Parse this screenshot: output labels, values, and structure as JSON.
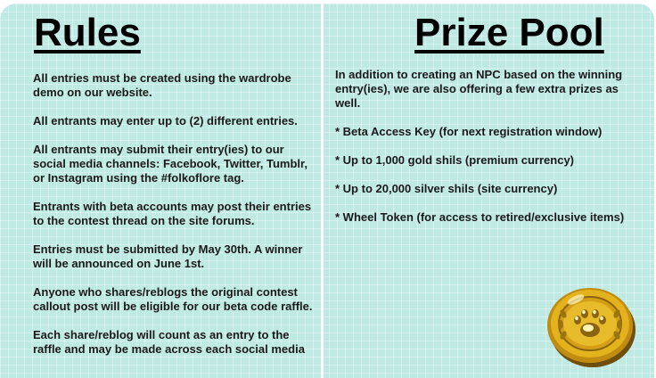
{
  "rules": {
    "title": "Rules",
    "paragraphs": [
      "All entries must be created using the wardrobe demo on our website.",
      "All entrants may enter up to (2) different entries.",
      "All entrants may submit their entry(ies) to our social media channels: Facebook, Twitter, Tumblr, or Instagram using the #folkoflore tag.",
      "Entrants with beta accounts may post their entries to the contest thread on the site forums.",
      "Entries must be submitted by May 30th. A winner will be announced on June 1st.",
      "Anyone who shares/reblogs the original contest callout post will be eligible for our beta code raffle.",
      "Each share/reblog will count as an entry to the raffle and may be made across each social media"
    ]
  },
  "prize_pool": {
    "title": "Prize Pool",
    "intro": "In addition to creating an NPC based on the winning entry(ies), we are also offering a few extra prizes as well.",
    "items": [
      "* Beta Access Key (for next registration window)",
      "* Up to 1,000 gold shils (premium currency)",
      "* Up to 20,000 silver shils (site currency)",
      "* Wheel Token (for access to retired/exclusive items)"
    ]
  },
  "colors": {
    "background": "#bfe9e3",
    "divider": "#ffffff",
    "coin_gold": "#e3b21c",
    "coin_dark": "#8a6410"
  },
  "icons": {
    "coin": "gold-coin-paw-icon"
  }
}
